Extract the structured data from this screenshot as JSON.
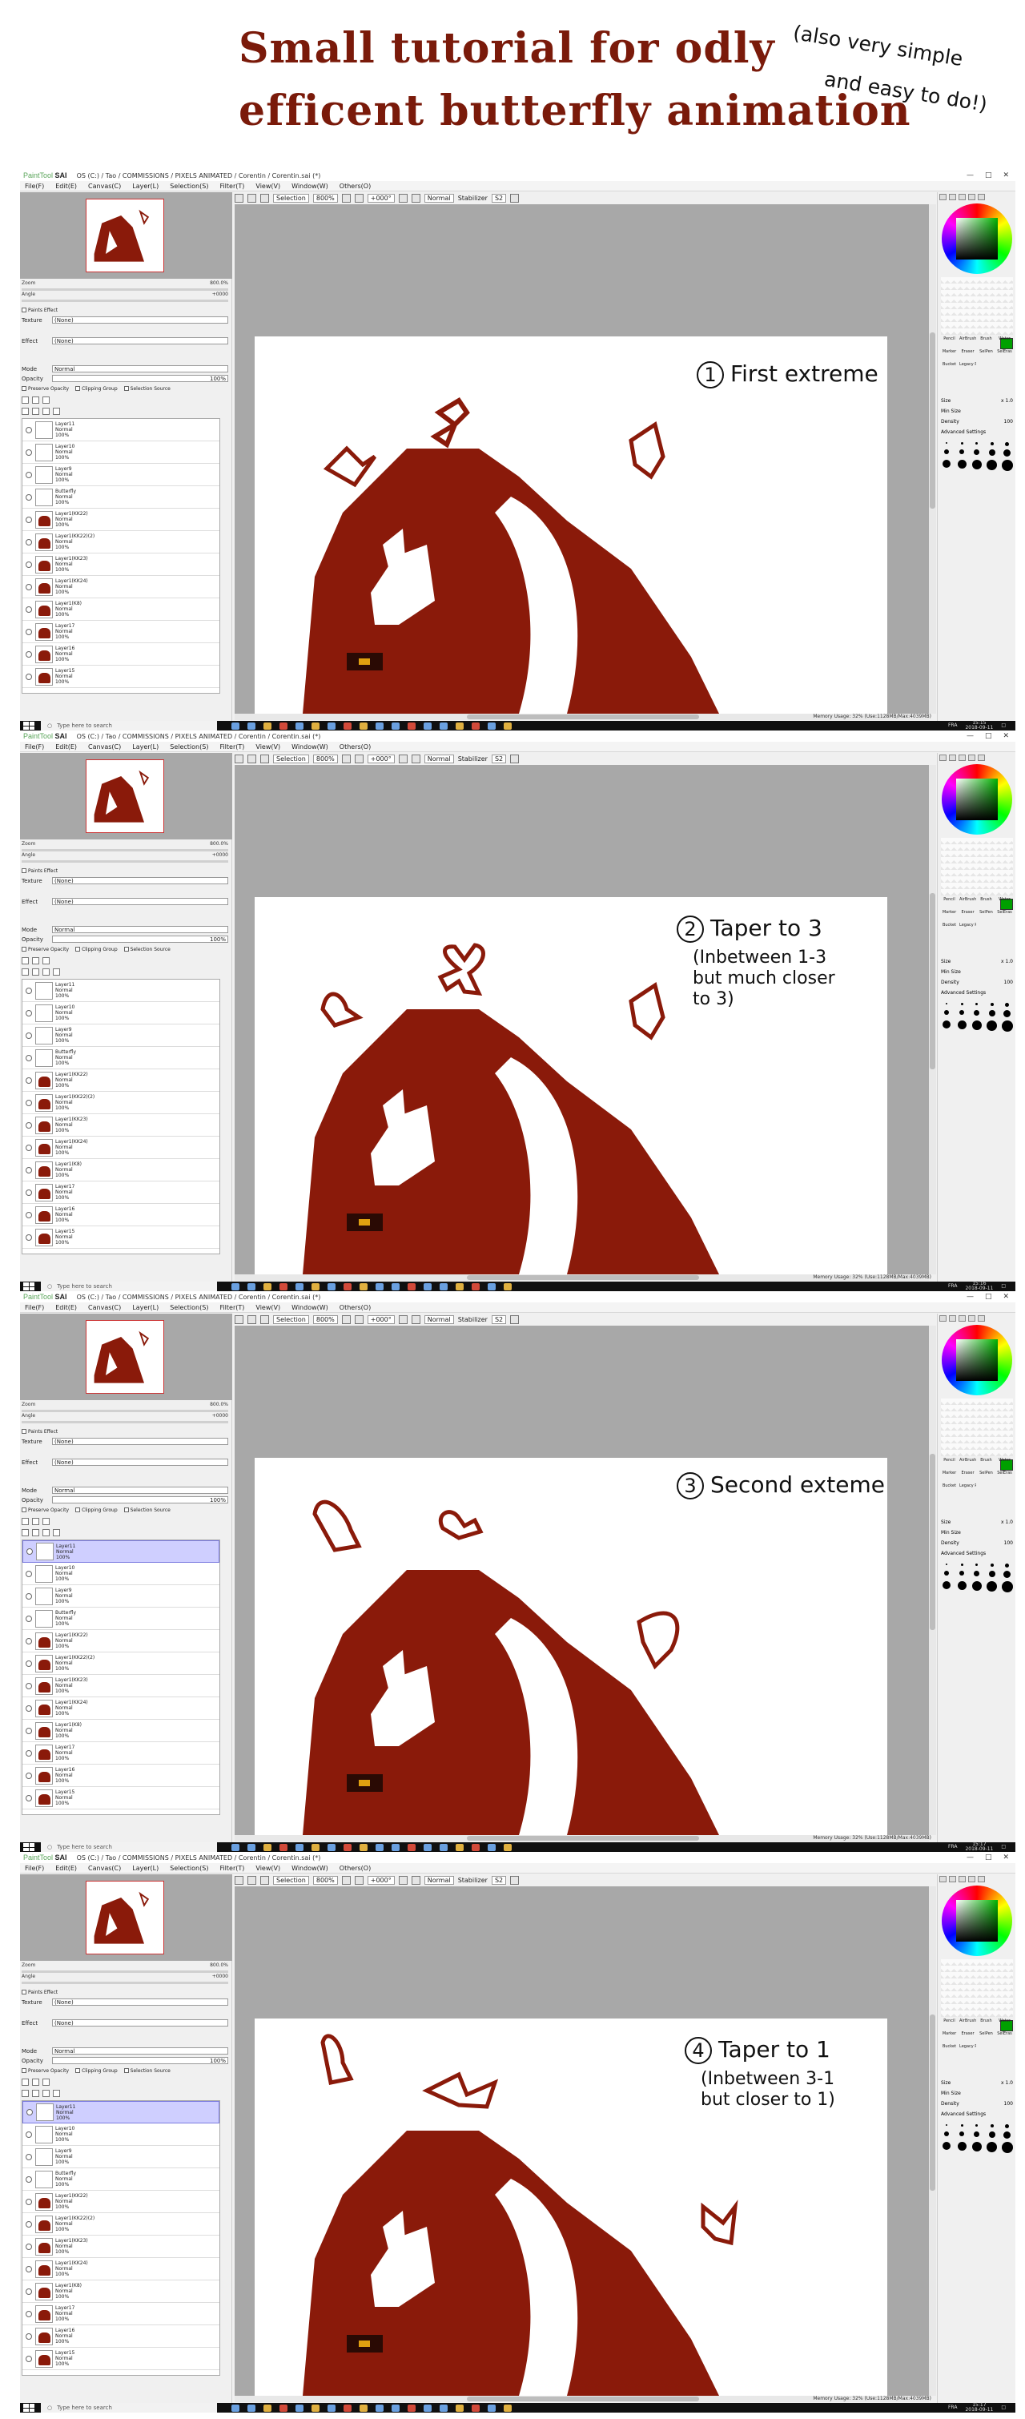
{
  "header": {
    "title_line1": "Small tutorial for odly",
    "title_line2": "efficent butterfly animation",
    "note_line1": "(also very simple",
    "note_line2": "and easy to do!)"
  },
  "app": {
    "logo_prefix": "PaintTool",
    "logo_name": "SAI",
    "path": "OS (C:) / Tao / COMMISSIONS / PIXELS ANIMATED / Corentin / Corentin.sai (*)",
    "menu": [
      "File(F)",
      "Edit(E)",
      "Canvas(C)",
      "Layer(L)",
      "Selection(S)",
      "Filter(T)",
      "View(V)",
      "Window(W)",
      "Others(O)"
    ],
    "toolbar": {
      "selection": "Selection",
      "zoom": "800%",
      "angle": "+000°",
      "mode": "Normal",
      "stabilizer_label": "Stabilizer",
      "stabilizer": "S2"
    },
    "nav": {
      "zoom_label": "Zoom",
      "zoom_value": "800.0%",
      "angle_label": "Angle",
      "angle_value": "+0000"
    },
    "props": {
      "section": "Paints Effect",
      "texture_label": "Texture",
      "texture_value": "(None)",
      "effect_label": "Effect",
      "effect_value": "(None)",
      "mode_label": "Mode",
      "mode_value": "Normal",
      "opacity_label": "Opacity",
      "opacity_value": "100%",
      "preserve": "Preserve Opacity",
      "clipping": "Clipping Group",
      "selsource": "Selection Source"
    },
    "doc_tab": {
      "name": "Corentin.sai",
      "zoom": "800%"
    },
    "memory": "Memory Usage: 32% (Use:1128MB/Max:4039MB)",
    "taskbar": {
      "search": "Type here to search",
      "lang": "FRA",
      "date": "2018-09-11"
    },
    "right": {
      "size_label": "Size",
      "size_value": "x 1.0",
      "minsize_label": "Min Size",
      "density_label": "Density",
      "density_value": "100",
      "adv": "Advanced Settings"
    },
    "tools": [
      "Pencil",
      "AirBrush",
      "Brush",
      "Water",
      "Marker",
      "Eraser",
      "SelPen",
      "SelEras",
      "Bucket",
      "Legacy Pen",
      "",
      ""
    ]
  },
  "frames": [
    {
      "time": "15:15",
      "annotation": {
        "num": "1",
        "main": "First extreme",
        "sub": []
      },
      "selected_layer": -1,
      "layers": [
        {
          "name": "Layer11",
          "mode": "Normal",
          "opacity": "100%",
          "thumb": false
        },
        {
          "name": "Layer10",
          "mode": "Normal",
          "opacity": "100%",
          "thumb": false
        },
        {
          "name": "Layer9",
          "mode": "Normal",
          "opacity": "100%",
          "thumb": false
        },
        {
          "name": "Butterfly",
          "mode": "Normal",
          "opacity": "100%",
          "thumb": false
        },
        {
          "name": "Layer1(KK22)",
          "mode": "Normal",
          "opacity": "100%",
          "thumb": true
        },
        {
          "name": "Layer1(KK22)(2)",
          "mode": "Normal",
          "opacity": "100%",
          "thumb": true
        },
        {
          "name": "Layer1(KK23)",
          "mode": "Normal",
          "opacity": "100%",
          "thumb": true
        },
        {
          "name": "Layer1(KK24)",
          "mode": "Normal",
          "opacity": "100%",
          "thumb": true
        },
        {
          "name": "Layer1(K8)",
          "mode": "Normal",
          "opacity": "100%",
          "thumb": true
        },
        {
          "name": "Layer17",
          "mode": "Normal",
          "opacity": "100%",
          "thumb": true
        },
        {
          "name": "Layer16",
          "mode": "Normal",
          "opacity": "100%",
          "thumb": true
        },
        {
          "name": "Layer15",
          "mode": "Normal",
          "opacity": "100%",
          "thumb": true
        }
      ]
    },
    {
      "time": "15:16",
      "annotation": {
        "num": "2",
        "main": "Taper to 3",
        "sub": [
          "(Inbetween 1-3",
          "but much closer",
          "to 3)"
        ]
      },
      "selected_layer": -1,
      "layers": [
        {
          "name": "Layer11",
          "mode": "Normal",
          "opacity": "100%",
          "thumb": false
        },
        {
          "name": "Layer10",
          "mode": "Normal",
          "opacity": "100%",
          "thumb": false
        },
        {
          "name": "Layer9",
          "mode": "Normal",
          "opacity": "100%",
          "thumb": false
        },
        {
          "name": "Butterfly",
          "mode": "Normal",
          "opacity": "100%",
          "thumb": false
        },
        {
          "name": "Layer1(KK22)",
          "mode": "Normal",
          "opacity": "100%",
          "thumb": true
        },
        {
          "name": "Layer1(KK22)(2)",
          "mode": "Normal",
          "opacity": "100%",
          "thumb": true
        },
        {
          "name": "Layer1(KK23)",
          "mode": "Normal",
          "opacity": "100%",
          "thumb": true
        },
        {
          "name": "Layer1(KK24)",
          "mode": "Normal",
          "opacity": "100%",
          "thumb": true
        },
        {
          "name": "Layer1(K8)",
          "mode": "Normal",
          "opacity": "100%",
          "thumb": true
        },
        {
          "name": "Layer17",
          "mode": "Normal",
          "opacity": "100%",
          "thumb": true
        },
        {
          "name": "Layer16",
          "mode": "Normal",
          "opacity": "100%",
          "thumb": true
        },
        {
          "name": "Layer15",
          "mode": "Normal",
          "opacity": "100%",
          "thumb": true
        }
      ]
    },
    {
      "time": "15:17",
      "annotation": {
        "num": "3",
        "main": "Second exteme",
        "sub": []
      },
      "selected_layer": 0,
      "layers": [
        {
          "name": "Layer11",
          "mode": "Normal",
          "opacity": "100%",
          "thumb": false
        },
        {
          "name": "Layer10",
          "mode": "Normal",
          "opacity": "100%",
          "thumb": false
        },
        {
          "name": "Layer9",
          "mode": "Normal",
          "opacity": "100%",
          "thumb": false
        },
        {
          "name": "Butterfly",
          "mode": "Normal",
          "opacity": "100%",
          "thumb": false
        },
        {
          "name": "Layer1(KK22)",
          "mode": "Normal",
          "opacity": "100%",
          "thumb": true
        },
        {
          "name": "Layer1(KK22)(2)",
          "mode": "Normal",
          "opacity": "100%",
          "thumb": true
        },
        {
          "name": "Layer1(KK23)",
          "mode": "Normal",
          "opacity": "100%",
          "thumb": true
        },
        {
          "name": "Layer1(KK24)",
          "mode": "Normal",
          "opacity": "100%",
          "thumb": true
        },
        {
          "name": "Layer1(K8)",
          "mode": "Normal",
          "opacity": "100%",
          "thumb": true
        },
        {
          "name": "Layer17",
          "mode": "Normal",
          "opacity": "100%",
          "thumb": true
        },
        {
          "name": "Layer16",
          "mode": "Normal",
          "opacity": "100%",
          "thumb": true
        },
        {
          "name": "Layer15",
          "mode": "Normal",
          "opacity": "100%",
          "thumb": true
        }
      ]
    },
    {
      "time": "15:17",
      "annotation": {
        "num": "4",
        "main": "Taper to 1",
        "sub": [
          "(Inbetween 3-1",
          "but closer to 1)"
        ]
      },
      "selected_layer": 0,
      "layers": [
        {
          "name": "Layer11",
          "mode": "Normal",
          "opacity": "100%",
          "thumb": false
        },
        {
          "name": "Layer10",
          "mode": "Normal",
          "opacity": "100%",
          "thumb": false
        },
        {
          "name": "Layer9",
          "mode": "Normal",
          "opacity": "100%",
          "thumb": false
        },
        {
          "name": "Butterfly",
          "mode": "Normal",
          "opacity": "100%",
          "thumb": false
        },
        {
          "name": "Layer1(KK22)",
          "mode": "Normal",
          "opacity": "100%",
          "thumb": true
        },
        {
          "name": "Layer1(KK22)(2)",
          "mode": "Normal",
          "opacity": "100%",
          "thumb": true
        },
        {
          "name": "Layer1(KK23)",
          "mode": "Normal",
          "opacity": "100%",
          "thumb": true
        },
        {
          "name": "Layer1(KK24)",
          "mode": "Normal",
          "opacity": "100%",
          "thumb": true
        },
        {
          "name": "Layer1(K8)",
          "mode": "Normal",
          "opacity": "100%",
          "thumb": true
        },
        {
          "name": "Layer17",
          "mode": "Normal",
          "opacity": "100%",
          "thumb": true
        },
        {
          "name": "Layer16",
          "mode": "Normal",
          "opacity": "100%",
          "thumb": true
        },
        {
          "name": "Layer15",
          "mode": "Normal",
          "opacity": "100%",
          "thumb": true
        }
      ]
    }
  ],
  "colors": {
    "title": "#7a1a0a",
    "artwork": "#8a1a0a",
    "canvas_bg": "#a8a8a8",
    "layer_selected": "#cfcfff"
  }
}
